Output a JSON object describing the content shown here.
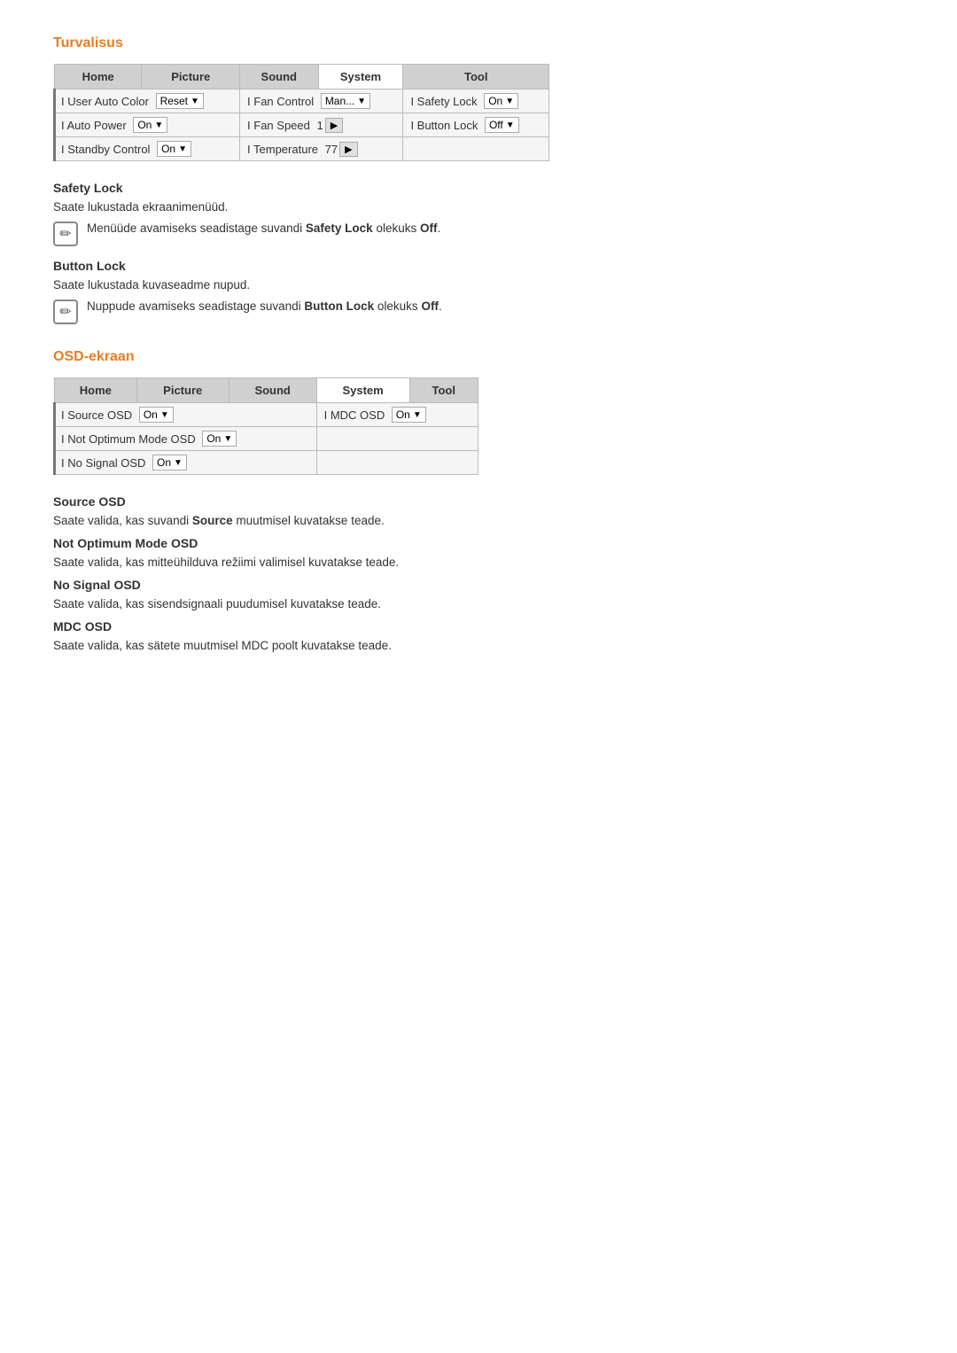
{
  "turvalisus": {
    "title": "Turvalisus",
    "menu": {
      "tabs": [
        "Home",
        "Picture",
        "Sound",
        "System",
        "Tool"
      ],
      "active_tab": "System",
      "rows": [
        {
          "col1_label": "User Auto Color",
          "col1_val": "Reset",
          "col1_type": "dropdown",
          "col2_label": "Fan Control",
          "col2_val": "Man...",
          "col2_type": "dropdown",
          "col3_label": "Safety Lock",
          "col3_val": "On",
          "col3_type": "dropdown"
        },
        {
          "col1_label": "Auto Power",
          "col1_val": "On",
          "col1_type": "dropdown",
          "col2_label": "Fan Speed",
          "col2_val": "1",
          "col2_type": "arrow",
          "col3_label": "Button Lock",
          "col3_val": "Off",
          "col3_type": "dropdown"
        },
        {
          "col1_label": "Standby Control",
          "col1_val": "On",
          "col1_type": "dropdown",
          "col2_label": "Temperature",
          "col2_val": "77",
          "col2_type": "arrow",
          "col3_label": "",
          "col3_val": "",
          "col3_type": ""
        }
      ]
    },
    "safety_lock": {
      "heading": "Safety Lock",
      "para": "Saate lukustada ekraanimenüüd.",
      "note": "Menüüde avamiseks seadistage suvandi Safety Lock olekuks Off.",
      "note_bold1": "Safety Lock",
      "note_bold2": "Off"
    },
    "button_lock": {
      "heading": "Button Lock",
      "para": "Saate lukustada kuvaseadme nupud.",
      "note": "Nuppude avamiseks seadistage suvandi Button Lock olekuks Off.",
      "note_bold1": "Button Lock",
      "note_bold2": "Off"
    }
  },
  "osd_ekraan": {
    "title": "OSD-ekraan",
    "menu": {
      "tabs": [
        "Home",
        "Picture",
        "Sound",
        "System",
        "Tool"
      ],
      "active_tab": "System",
      "rows": [
        {
          "col1_label": "Source OSD",
          "col1_val": "On",
          "col1_type": "dropdown",
          "col2_label": "MDC OSD",
          "col2_val": "On",
          "col2_type": "dropdown"
        },
        {
          "col1_label": "Not Optimum Mode OSD",
          "col1_val": "On",
          "col1_type": "dropdown",
          "col2_label": "",
          "col2_val": "",
          "col2_type": ""
        },
        {
          "col1_label": "No Signal OSD",
          "col1_val": "On",
          "col1_type": "dropdown",
          "col2_label": "",
          "col2_val": "",
          "col2_type": ""
        }
      ]
    },
    "source_osd": {
      "heading": "Source OSD",
      "para": "Saate valida, kas suvandi Source muutmisel kuvatakse teade.",
      "bold": "Source"
    },
    "not_optimum": {
      "heading": "Not Optimum Mode OSD",
      "para": "Saate valida, kas mitteühilduva režiimi valimisel kuvatakse teade."
    },
    "no_signal": {
      "heading": "No Signal OSD",
      "para": "Saate valida, kas sisendsignaali puudumisel kuvatakse teade."
    },
    "mdc_osd": {
      "heading": "MDC OSD",
      "para": "Saate valida, kas sätete muutmisel MDC poolt kuvatakse teade."
    }
  },
  "icons": {
    "pencil_symbol": "✏"
  }
}
